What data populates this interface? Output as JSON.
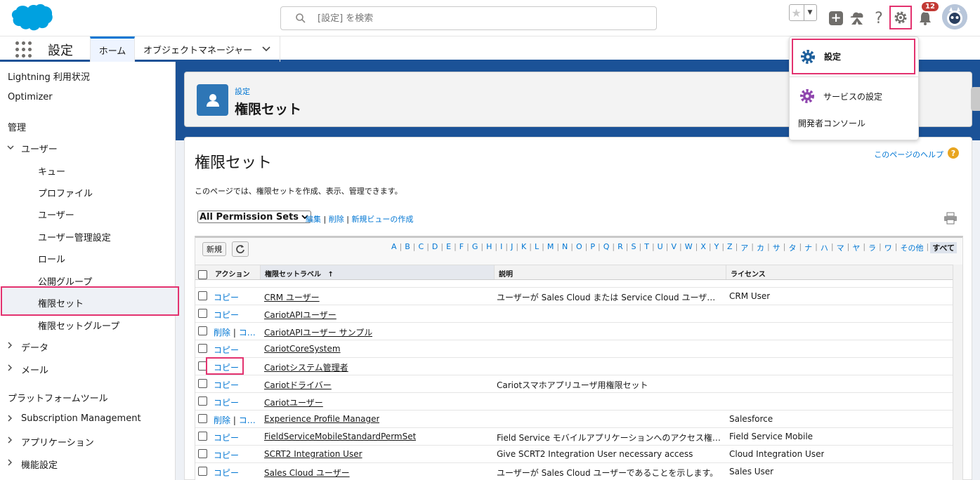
{
  "header": {
    "search_placeholder": "[設定] を検索",
    "notification_count": "12",
    "help_glyph": "?"
  },
  "nav": {
    "app_name": "設定",
    "tabs": [
      {
        "label": "ホーム"
      },
      {
        "label": "オブジェクトマネージャー"
      }
    ]
  },
  "sidebar": {
    "items": [
      {
        "label": "Lightning 利用状況"
      },
      {
        "label": "Optimizer"
      },
      {
        "label": "管理"
      },
      {
        "label": "ユーザー"
      },
      {
        "label": "キュー"
      },
      {
        "label": "プロファイル"
      },
      {
        "label": "ユーザー"
      },
      {
        "label": "ユーザー管理設定"
      },
      {
        "label": "ロール"
      },
      {
        "label": "公開グループ"
      },
      {
        "label": "権限セット"
      },
      {
        "label": "権限セットグループ"
      },
      {
        "label": "データ"
      },
      {
        "label": "メール"
      },
      {
        "label": "プラットフォームツール"
      },
      {
        "label": "Subscription Management"
      },
      {
        "label": "アプリケーション"
      },
      {
        "label": "機能設定"
      }
    ]
  },
  "page_header": {
    "breadcrumb": "設定",
    "title": "権限セット"
  },
  "main": {
    "title": "権限セット",
    "help_link": "このページのヘルプ",
    "description": "このページでは、権限セットを作成、表示、管理できます。",
    "view_select": "All Permission Sets",
    "view_links": {
      "edit": "編集",
      "delete": "削除",
      "new_view": "新規ビューの作成",
      "sep": "|"
    },
    "new_button": "新規",
    "alphabet": [
      "A",
      "B",
      "C",
      "D",
      "E",
      "F",
      "G",
      "H",
      "I",
      "J",
      "K",
      "L",
      "M",
      "N",
      "O",
      "P",
      "Q",
      "R",
      "S",
      "T",
      "U",
      "V",
      "W",
      "X",
      "Y",
      "Z",
      "ア",
      "カ",
      "サ",
      "タ",
      "ナ",
      "ハ",
      "マ",
      "ヤ",
      "ラ",
      "ワ",
      "その他"
    ],
    "alphabet_current": "すべて",
    "columns": {
      "action": "アクション",
      "label": "権限セットラベル",
      "label_sort": "↑",
      "description": "説明",
      "license": "ライセンス"
    },
    "rows": [
      {
        "actions": [
          "コピー"
        ],
        "label": "CRM ユーザー",
        "description": "ユーザーが Sales Cloud または Service Cloud ユーザーで…",
        "license": "CRM User"
      },
      {
        "actions": [
          "コピー"
        ],
        "label": "CariotAPIユーザー",
        "description": "",
        "license": ""
      },
      {
        "actions": [
          "削除",
          "コ…"
        ],
        "label": "CariotAPIユーザー サンプル",
        "description": "",
        "license": ""
      },
      {
        "actions": [
          "コピー"
        ],
        "label": "CariotCoreSystem",
        "description": "",
        "license": ""
      },
      {
        "actions": [
          "コピー"
        ],
        "label": "Cariotシステム管理者",
        "description": "",
        "license": ""
      },
      {
        "actions": [
          "コピー"
        ],
        "label": "Cariotドライバー",
        "description": "Cariotスマホアプリユーザ用権限セット",
        "license": ""
      },
      {
        "actions": [
          "コピー"
        ],
        "label": "Cariotユーザー",
        "description": "",
        "license": ""
      },
      {
        "actions": [
          "削除",
          "コ…"
        ],
        "label": "Experience Profile Manager",
        "description": "",
        "license": "Salesforce"
      },
      {
        "actions": [
          "コピー"
        ],
        "label": "FieldServiceMobileStandardPermSet",
        "description": "Field Service モバイルアプリケーションへのアクセス権を派…",
        "license": "Field Service Mobile"
      },
      {
        "actions": [
          "コピー"
        ],
        "label": "SCRT2 Integration User",
        "description": "Give SCRT2 Integration User necessary access",
        "license": "Cloud Integration User"
      },
      {
        "actions": [
          "コピー"
        ],
        "label": "Sales Cloud ユーザー",
        "description": "ユーザーが Sales Cloud ユーザーであることを示します。",
        "license": "Sales User"
      }
    ]
  },
  "setup_menu": {
    "items": [
      {
        "label": "設定"
      },
      {
        "label": "サービスの設定"
      },
      {
        "label": "開発者コンソール"
      }
    ]
  },
  "colors": {
    "brand_blue": "#1b5297",
    "link": "#0176d3",
    "highlight": "#e3326f",
    "badge": "#c23934"
  }
}
